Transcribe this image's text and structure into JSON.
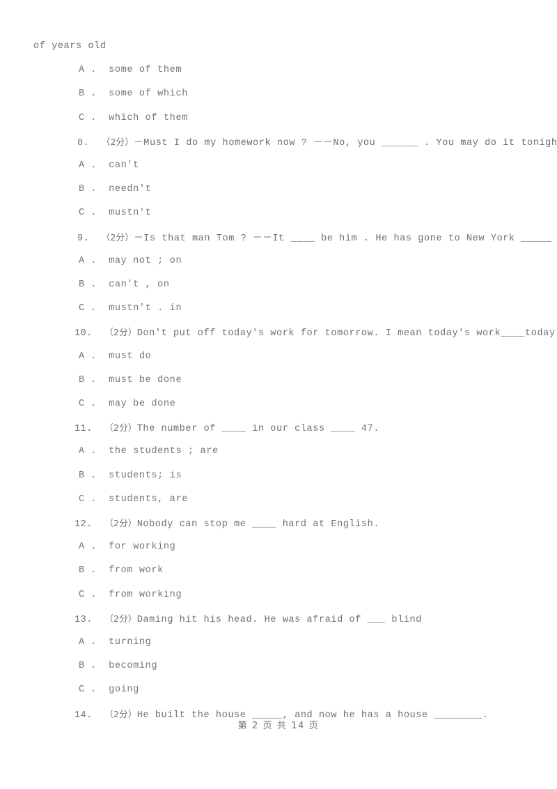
{
  "document": {
    "type": "exam-worksheet",
    "continued_stem": "of years old",
    "footer": "第 2 页 共 14 页",
    "page_number": "2",
    "total_pages": "14",
    "text_color": "#727272",
    "background_color": "#ffffff"
  },
  "orphan_options": [
    {
      "letter": "A",
      "sep": " .",
      "text": "some of them"
    },
    {
      "letter": "B",
      "sep": " .",
      "text": "some of which"
    },
    {
      "letter": "C",
      "sep": " .",
      "text": "which of them"
    }
  ],
  "questions": [
    {
      "number": "8.",
      "score": "（2分）",
      "text": "－Must I do my homework now ? －－No, you ______ . You may do it tonight.",
      "options": [
        {
          "letter": "A",
          "sep": " .",
          "text": "can't"
        },
        {
          "letter": "B",
          "sep": " .",
          "text": "needn't"
        },
        {
          "letter": "C",
          "sep": " .",
          "text": "mustn't"
        }
      ]
    },
    {
      "number": "9.",
      "score": "（2分）",
      "text": "－Is that man Tom ? －－It ____ be him . He has gone to New York _____ business.",
      "options": [
        {
          "letter": "A",
          "sep": " .",
          "text": "may not ; on"
        },
        {
          "letter": "B",
          "sep": " .",
          "text": "can't , on"
        },
        {
          "letter": "C",
          "sep": " .",
          "text": "mustn't . in"
        }
      ]
    },
    {
      "number": "10.",
      "score": "（2分）",
      "text": "Don't put off today's work for tomorrow. I mean today's work____today.",
      "options": [
        {
          "letter": "A",
          "sep": " .",
          "text": "must do"
        },
        {
          "letter": "B",
          "sep": " .",
          "text": "must be done"
        },
        {
          "letter": "C",
          "sep": " .",
          "text": "may be done"
        }
      ]
    },
    {
      "number": "11.",
      "score": "（2分）",
      "text": "The number of ____ in our class ____ 47.",
      "options": [
        {
          "letter": "A",
          "sep": " .",
          "text": "the students ; are"
        },
        {
          "letter": "B",
          "sep": " .",
          "text": "students; is"
        },
        {
          "letter": "C",
          "sep": " .",
          "text": "students, are"
        }
      ]
    },
    {
      "number": "12.",
      "score": "（2分）",
      "text": "Nobody can stop me ____ hard at English.",
      "options": [
        {
          "letter": "A",
          "sep": " .",
          "text": "for working"
        },
        {
          "letter": "B",
          "sep": " .",
          "text": "from work"
        },
        {
          "letter": "C",
          "sep": " .",
          "text": "from working"
        }
      ]
    },
    {
      "number": "13.",
      "score": "（2分）",
      "text": "Daming hit his head. He was afraid of ___ blind",
      "options": [
        {
          "letter": "A",
          "sep": " .",
          "text": "turning"
        },
        {
          "letter": "B",
          "sep": " .",
          "text": "becoming"
        },
        {
          "letter": "C",
          "sep": " .",
          "text": "going"
        }
      ]
    },
    {
      "number": "14.",
      "score": "（2分）",
      "text": "He built the house _____, and now he has a house ________.",
      "options": []
    }
  ]
}
